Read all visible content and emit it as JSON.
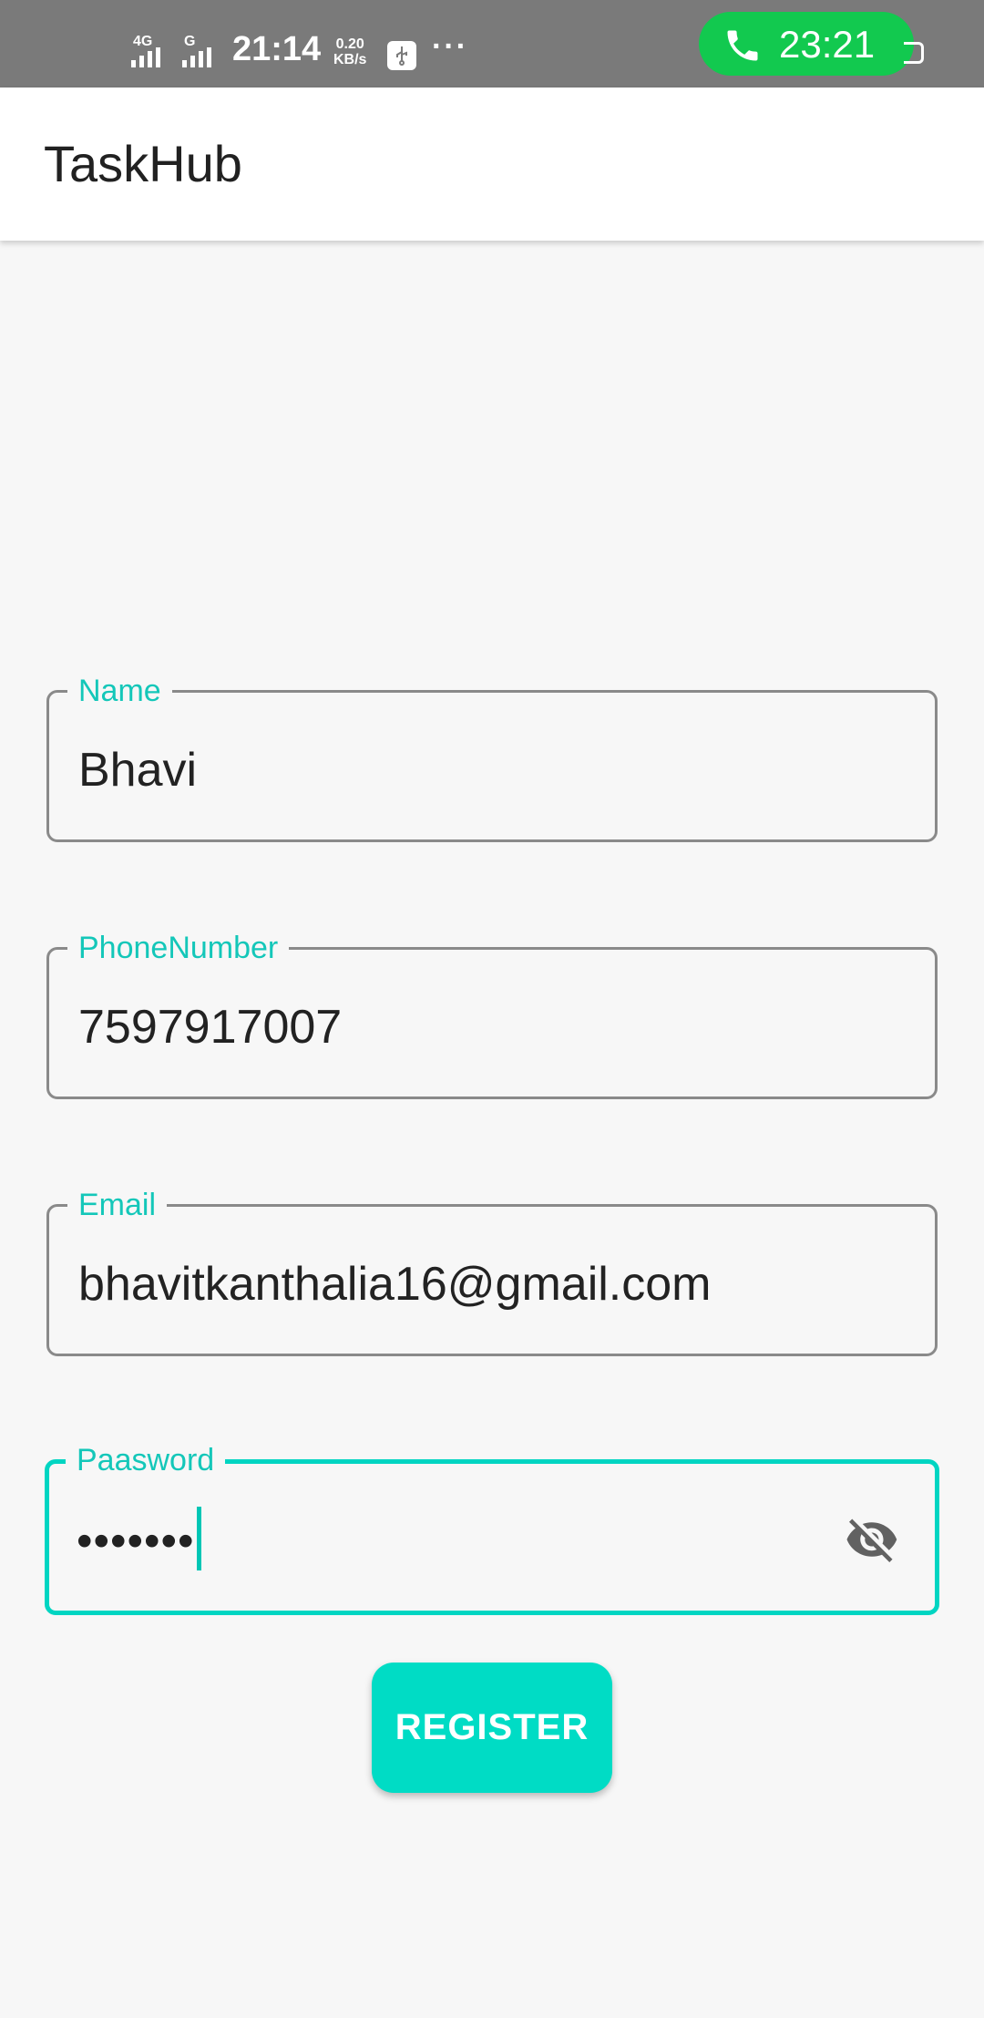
{
  "status_bar": {
    "signal1_tag": "4G",
    "signal2_tag": "G",
    "time": "21:14",
    "speed_value": "0.20",
    "speed_unit": "KB/s",
    "more": "···",
    "call_time": "23:21",
    "call_color": "#12c94f"
  },
  "app_bar": {
    "title": "TaskHub"
  },
  "form": {
    "name_label": "Name",
    "name_value": "Bhavi",
    "phone_label": "PhoneNumber",
    "phone_value": "7597917007",
    "email_label": "Email",
    "email_value": "bhavitkanthalia16@gmail.com",
    "password_label": "Paasword",
    "password_value": "•••••••",
    "accent_color": "#00d5c2"
  },
  "register_label": "REGISTER"
}
